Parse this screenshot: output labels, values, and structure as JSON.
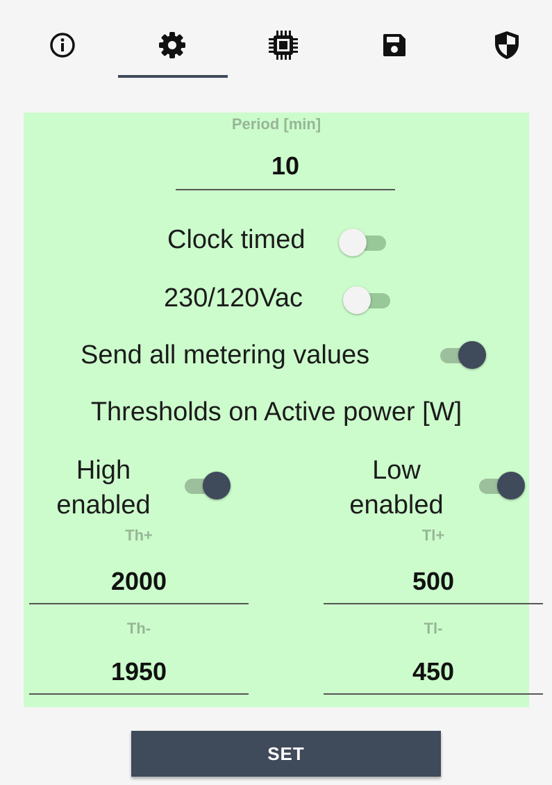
{
  "tabs": [
    {
      "icon": "info-icon"
    },
    {
      "icon": "gear-icon",
      "selected": true
    },
    {
      "icon": "chip-icon"
    },
    {
      "icon": "save-icon"
    },
    {
      "icon": "shield-icon"
    }
  ],
  "colors": {
    "panel_background": "#ccfccc",
    "accent": "#3f4a5a",
    "label": "#97b597"
  },
  "period": {
    "label": "Period [min]",
    "value": "10"
  },
  "clock_timed": {
    "label": "Clock timed",
    "on": false
  },
  "voltage": {
    "label": "230/120Vac",
    "on": false
  },
  "send_all": {
    "label": "Send all metering values",
    "on": true
  },
  "thresholds_title": "Thresholds on Active power [W]",
  "high": {
    "label_line1": "High",
    "label_line2": "enabled",
    "on": true,
    "th_plus_label": "Th+",
    "th_plus_value": "2000",
    "th_minus_label": "Th-",
    "th_minus_value": "1950"
  },
  "low": {
    "label_line1": "Low",
    "label_line2": "enabled",
    "on": true,
    "tl_plus_label": "Tl+",
    "tl_plus_value": "500",
    "tl_minus_label": "Tl-",
    "tl_minus_value": "450"
  },
  "set_button": "SET"
}
